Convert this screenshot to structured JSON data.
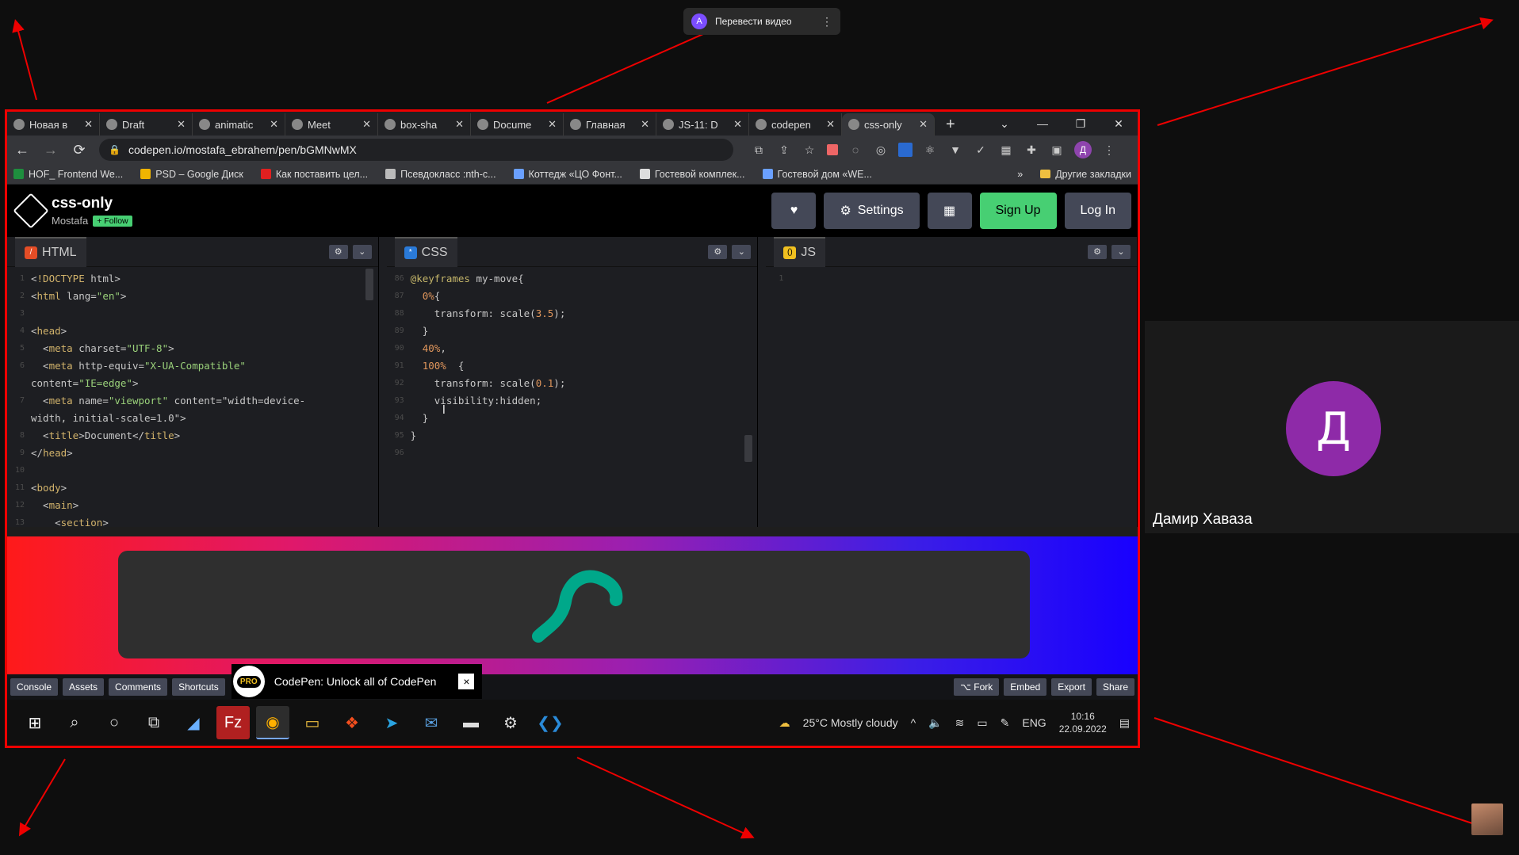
{
  "translate_pill": {
    "label": "Перевести видео",
    "logo_text": "A"
  },
  "tabs": [
    {
      "label": "Новая в",
      "active": false
    },
    {
      "label": "Draft",
      "active": false
    },
    {
      "label": "animatic",
      "active": false
    },
    {
      "label": "Meet",
      "active": false
    },
    {
      "label": "box-sha",
      "active": false
    },
    {
      "label": "Docume",
      "active": false
    },
    {
      "label": "Главная",
      "active": false
    },
    {
      "label": "JS-11: D",
      "active": false
    },
    {
      "label": "codepen",
      "active": false
    },
    {
      "label": "css-only",
      "active": true
    }
  ],
  "address": {
    "url": "codepen.io/mostafa_ebrahem/pen/bGMNwMX"
  },
  "bookmarks": [
    "HOF_ Frontend We...",
    "PSD – Google Диск",
    "Как поставить цел...",
    "Псевдокласс :nth-c...",
    "Коттедж «ЦО Фонт...",
    "Гостевой комплек...",
    "Гостевой дом «WE..."
  ],
  "bookmarks_more": "»",
  "bookmarks_other": "Другие закладки",
  "profile_letter": "Д",
  "pen": {
    "title": "css-only",
    "author": "Mostafa",
    "follow": "+ Follow"
  },
  "header_buttons": {
    "settings": "Settings",
    "signup": "Sign Up",
    "login": "Log In"
  },
  "editors": {
    "html": "HTML",
    "css": "CSS",
    "js": "JS"
  },
  "html_code": [
    [
      "1",
      "<!DOCTYPE html>"
    ],
    [
      "2",
      "<html lang=\"en\">"
    ],
    [
      "3",
      ""
    ],
    [
      "4",
      "<head>"
    ],
    [
      "5",
      "  <meta charset=\"UTF-8\">"
    ],
    [
      "6",
      "  <meta http-equiv=\"X-UA-Compatible\""
    ],
    [
      "",
      "content=\"IE=edge\">"
    ],
    [
      "7",
      "  <meta name=\"viewport\" content=\"width=device-"
    ],
    [
      "",
      "width, initial-scale=1.0\">"
    ],
    [
      "8",
      "  <title>Document</title>"
    ],
    [
      "9",
      "</head>"
    ],
    [
      "10",
      ""
    ],
    [
      "11",
      "<body>"
    ],
    [
      "12",
      "  <main>"
    ],
    [
      "13",
      "    <section>"
    ]
  ],
  "css_code": [
    [
      "86",
      "@keyframes my-move{"
    ],
    [
      "87",
      "  0%{"
    ],
    [
      "88",
      "    transform: scale(3.5);"
    ],
    [
      "89",
      "  }"
    ],
    [
      "90",
      "  40%,"
    ],
    [
      "91",
      "  100%  {"
    ],
    [
      "92",
      "    transform: scale(0.1);"
    ],
    [
      "93",
      "    visibility:hidden;"
    ],
    [
      "94",
      "  }"
    ],
    [
      "95",
      "}"
    ],
    [
      "96",
      ""
    ]
  ],
  "js_code": [
    [
      "1",
      ""
    ]
  ],
  "footer": {
    "console": "Console",
    "assets": "Assets",
    "comments": "Comments",
    "shortcuts": "Shortcuts",
    "promo_badge": "PRO",
    "promo_text": "CodePen: Unlock all of CodePen",
    "promo_close": "×",
    "fork": "⌥ Fork",
    "embed": "Embed",
    "export": "Export",
    "share": "Share"
  },
  "taskbar": {
    "weather": "25°C  Mostly cloudy",
    "lang": "ENG",
    "time": "10:16",
    "date": "22.09.2022"
  },
  "participant": {
    "initial": "Д",
    "name": "Дамир Хаваза"
  },
  "colors": {
    "frame": "#e00000",
    "codepen_green": "#47cf73",
    "avatar_purple": "#8e2aa8"
  }
}
